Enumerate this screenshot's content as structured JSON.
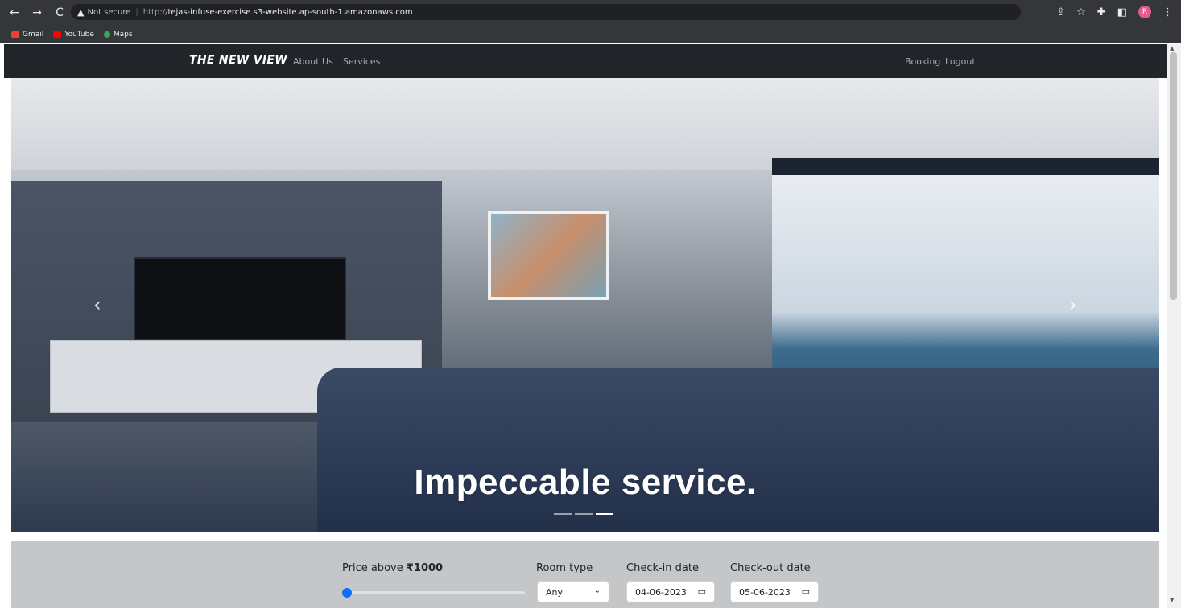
{
  "browser": {
    "nav": {
      "back": "←",
      "forward": "→",
      "reload": "C"
    },
    "security_label": "Not secure",
    "url_protocol": "http://",
    "url_host": "tejas-infuse-exercise.s3-website.ap-south-1.amazonaws.com",
    "bookmarks": [
      "Gmail",
      "YouTube",
      "Maps"
    ],
    "avatar_letter": "R"
  },
  "navbar": {
    "brand": "THE NEW VIEW",
    "left_links": [
      "About Us",
      "Services"
    ],
    "right_links": [
      "Booking",
      "Logout"
    ]
  },
  "hero": {
    "caption": "Impeccable service.",
    "slide_count": 3,
    "active_slide": 3,
    "prev": "‹",
    "next": "›"
  },
  "filters": {
    "price_label_prefix": "Price above",
    "price_value": "₹1000",
    "price_slider_fraction": 0.0,
    "room_type_label": "Room type",
    "room_type_value": "Any",
    "checkin_label": "Check-in date",
    "checkin_value": "04-06-2023",
    "checkout_label": "Check-out date",
    "checkout_value": "05-06-2023"
  }
}
